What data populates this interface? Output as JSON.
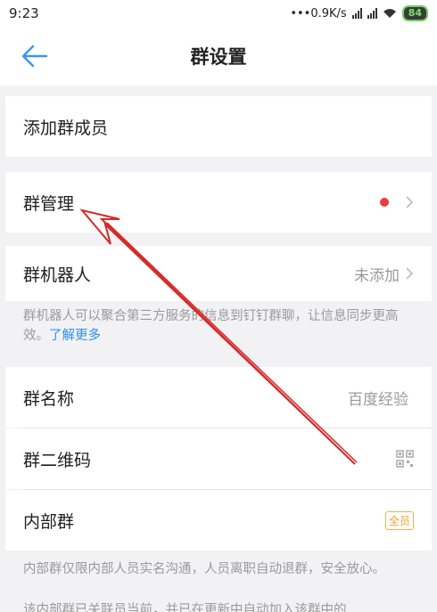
{
  "status_bar": {
    "time": "9:23",
    "net_speed": "0.9K/s",
    "battery": "84"
  },
  "nav": {
    "title": "群设置"
  },
  "rows": {
    "add_member": "添加群成员",
    "group_manage": "群管理",
    "group_robot": "群机器人",
    "group_robot_value": "未添加",
    "group_name": "群名称",
    "group_name_value": "百度经验",
    "group_qrcode": "群二维码",
    "internal_group": "内部群",
    "internal_group_badge": "全员"
  },
  "notes": {
    "robot_desc": "群机器人可以聚合第三方服务的信息到钉钉群聊，让信息同步更高效。",
    "learn_more": "了解更多",
    "internal_desc": "内部群仅限内部人员实名沟通，人员离职自动退群，安全放心。",
    "cutoff_text": "该内部群已关联员当前，并已在更新中自动加入该群中的"
  },
  "colors": {
    "accent": "#2b8ff0",
    "red_dot": "#ea3c3c",
    "badge": "#f0a030",
    "annotation": "#d62a2a"
  }
}
